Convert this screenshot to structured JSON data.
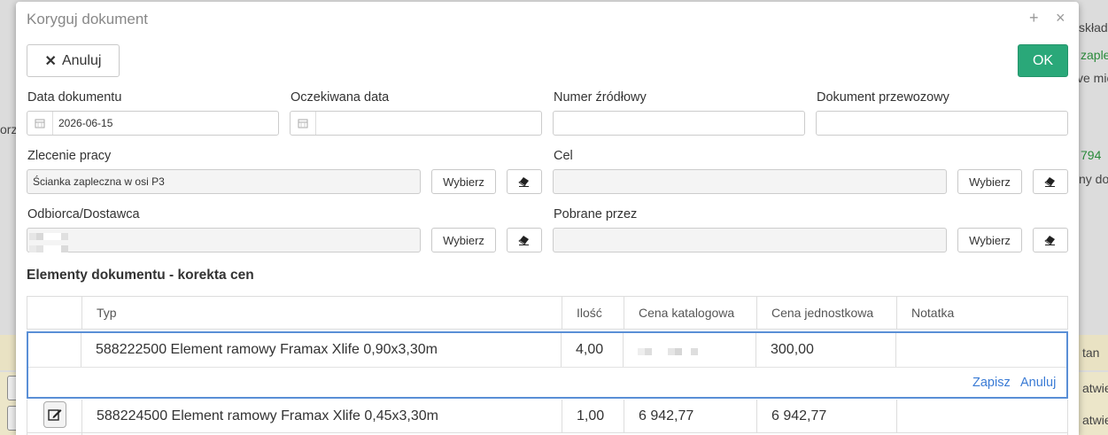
{
  "background": {
    "fragments": [
      "składe",
      "zaple",
      "ve mie",
      "orz",
      "794",
      "ny dol",
      "tan",
      "atwie",
      "atwie"
    ]
  },
  "modal": {
    "title": "Koryguj dokument",
    "controls": {
      "expand": "+",
      "close": "×"
    },
    "cancel_label": "Anuluj",
    "ok_label": "OK"
  },
  "fields": {
    "data_dokumentu": {
      "label": "Data dokumentu",
      "value": "2026-06-15"
    },
    "oczekiwana_data": {
      "label": "Oczekiwana data",
      "value": ""
    },
    "numer_zrodlowy": {
      "label": "Numer źródłowy",
      "value": ""
    },
    "dokument_przewozowy": {
      "label": "Dokument przewozowy",
      "value": ""
    },
    "zlecenie_pracy": {
      "label": "Zlecenie pracy",
      "value": "Ścianka zapleczna w osi P3"
    },
    "cel": {
      "label": "Cel",
      "value": ""
    },
    "odbiorca": {
      "label": "Odbiorca/Dostawca",
      "value": ""
    },
    "pobrane_przez": {
      "label": "Pobrane przez",
      "value": ""
    },
    "choose_label": "Wybierz"
  },
  "section_title": "Elementy dokumentu - korekta cen",
  "table": {
    "headers": [
      "",
      "Typ",
      "Ilość",
      "Cena katalogowa",
      "Cena jednostkowa",
      "Notatka"
    ],
    "edit_row": {
      "typ": "588222500 Element ramowy Framax Xlife 0,90x3,30m",
      "ilosc": "4,00",
      "cena_jednostkowa": "300,00",
      "save_label": "Zapisz",
      "cancel_label": "Anuluj"
    },
    "rows": [
      {
        "typ": "588224500 Element ramowy Framax Xlife 0,45x3,30m",
        "ilosc": "1,00",
        "cena_katalogowa": "6 942,77",
        "cena_jednostkowa": "6 942,77",
        "notatka": ""
      }
    ]
  },
  "colors": {
    "ok": "#2aa879",
    "link": "#3a7bd5",
    "edit_border": "#5a8fd6"
  }
}
